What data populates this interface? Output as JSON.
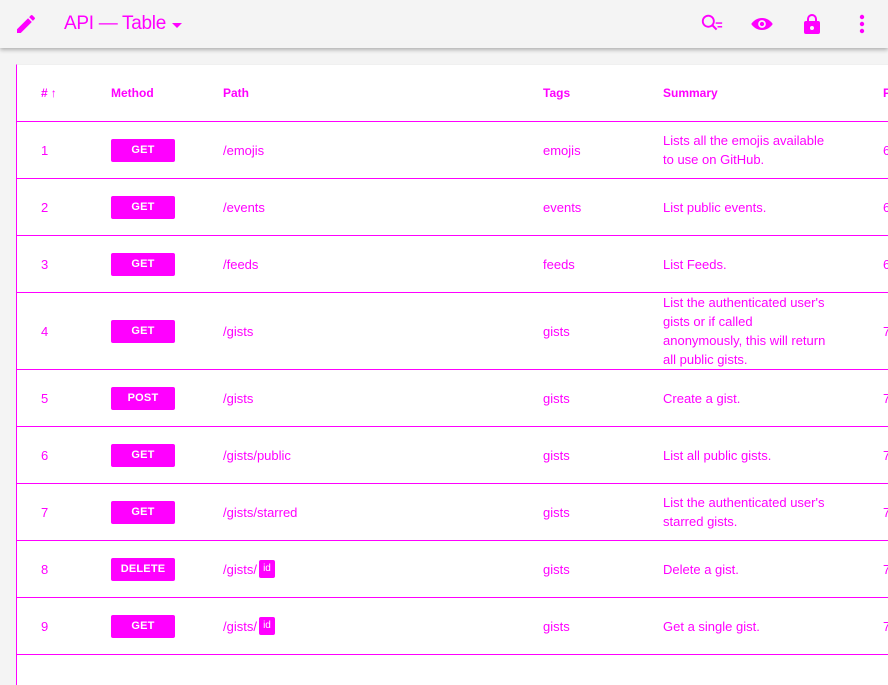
{
  "app": {
    "title": "API — Table",
    "icons": [
      "edit-icon",
      "search-icon",
      "visibility-icon",
      "lock-icon",
      "more-vert-icon"
    ]
  },
  "table": {
    "headers": {
      "num": "#",
      "sort": "↑",
      "method": "Method",
      "path": "Path",
      "tags": "Tags",
      "summary": "Summary",
      "extra": "P"
    },
    "rows": [
      {
        "num": "1",
        "method": "GET",
        "path": "/emojis",
        "param": "",
        "tags": "emojis",
        "summary": "Lists all the emojis available to use on GitHub.",
        "extra": "6"
      },
      {
        "num": "2",
        "method": "GET",
        "path": "/events",
        "param": "",
        "tags": "events",
        "summary": "List public events.",
        "extra": "6"
      },
      {
        "num": "3",
        "method": "GET",
        "path": "/feeds",
        "param": "",
        "tags": "feeds",
        "summary": "List Feeds.",
        "extra": "6"
      },
      {
        "num": "4",
        "method": "GET",
        "path": "/gists",
        "param": "",
        "tags": "gists",
        "summary": "List the authenticated user's gists or if called anonymously, this will return all public gists.",
        "extra": "7"
      },
      {
        "num": "5",
        "method": "POST",
        "path": "/gists",
        "param": "",
        "tags": "gists",
        "summary": "Create a gist.",
        "extra": "7"
      },
      {
        "num": "6",
        "method": "GET",
        "path": "/gists/public",
        "param": "",
        "tags": "gists",
        "summary": "List all public gists.",
        "extra": "7"
      },
      {
        "num": "7",
        "method": "GET",
        "path": "/gists/starred",
        "param": "",
        "tags": "gists",
        "summary": "List the authenticated user's starred gists.",
        "extra": "7"
      },
      {
        "num": "8",
        "method": "DELETE",
        "path": "/gists/",
        "param": "id",
        "tags": "gists",
        "summary": "Delete a gist.",
        "extra": "7"
      },
      {
        "num": "9",
        "method": "GET",
        "path": "/gists/",
        "param": "id",
        "tags": "gists",
        "summary": "Get a single gist.",
        "extra": "7"
      }
    ]
  },
  "colors": {
    "accent": "#ff00ff",
    "background": "#f4f4f4",
    "card": "#ffffff"
  }
}
